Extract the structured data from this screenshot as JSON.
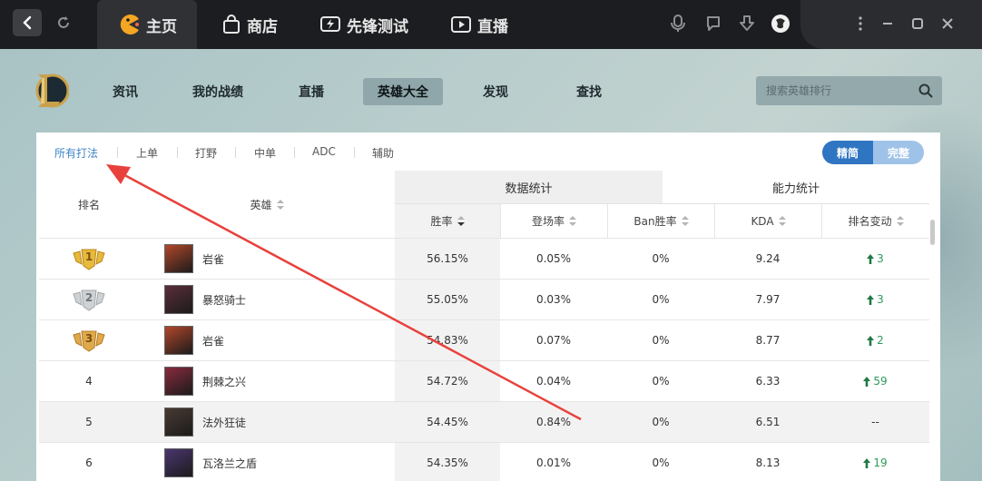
{
  "topbar": {
    "tabs": [
      {
        "label": "主页",
        "icon": "pacman-icon"
      },
      {
        "label": "商店",
        "icon": "shopping-bag-icon"
      },
      {
        "label": "先锋测试",
        "icon": "lightning-screen-icon"
      },
      {
        "label": "直播",
        "icon": "play-icon"
      }
    ],
    "active_tab": "主页",
    "accent": "#f5a623"
  },
  "subnav": {
    "items": [
      "资讯",
      "我的战绩",
      "直播",
      "英雄大全",
      "发现",
      "查找"
    ],
    "active": "英雄大全",
    "search_placeholder": "搜索英雄排行"
  },
  "filters": {
    "items": [
      "所有打法",
      "上单",
      "打野",
      "中单",
      "ADC",
      "辅助"
    ],
    "active": "所有打法",
    "toggle": {
      "left": "精简",
      "right": "完整",
      "selected": "精简"
    }
  },
  "table": {
    "group_headers": {
      "data": "数据统计",
      "ability": "能力统计"
    },
    "columns": {
      "rank": "排名",
      "hero": "英雄",
      "winrate": "胜率",
      "pickrate": "登场率",
      "banrate": "Ban胜率",
      "kda": "KDA",
      "change": "排名变动"
    },
    "rows": [
      {
        "rank": "1",
        "medal": "gold",
        "hero": "岩雀",
        "winrate": "56.15%",
        "pickrate": "0.05%",
        "banrate": "0%",
        "kda": "9.24",
        "change": "3",
        "trend": "up",
        "avatar_color": "#b2472a"
      },
      {
        "rank": "2",
        "medal": "silver",
        "hero": "暴怒骑士",
        "winrate": "55.05%",
        "pickrate": "0.03%",
        "banrate": "0%",
        "kda": "7.97",
        "change": "3",
        "trend": "up",
        "avatar_color": "#5b2f3a"
      },
      {
        "rank": "3",
        "medal": "bronze",
        "hero": "岩雀",
        "winrate": "54.83%",
        "pickrate": "0.07%",
        "banrate": "0%",
        "kda": "8.77",
        "change": "2",
        "trend": "up",
        "avatar_color": "#b2472a"
      },
      {
        "rank": "4",
        "medal": "none",
        "hero": "荆棘之兴",
        "winrate": "54.72%",
        "pickrate": "0.04%",
        "banrate": "0%",
        "kda": "6.33",
        "change": "59",
        "trend": "up",
        "avatar_color": "#8a2b3d"
      },
      {
        "rank": "5",
        "medal": "none",
        "hero": "法外狂徒",
        "winrate": "54.45%",
        "pickrate": "0.84%",
        "banrate": "0%",
        "kda": "6.51",
        "change": "--",
        "trend": "none",
        "avatar_color": "#4a3a33"
      },
      {
        "rank": "6",
        "medal": "none",
        "hero": "瓦洛兰之盾",
        "winrate": "54.35%",
        "pickrate": "0.01%",
        "banrate": "0%",
        "kda": "8.13",
        "change": "19",
        "trend": "up",
        "avatar_color": "#4b3670"
      }
    ]
  },
  "colors": {
    "trend_up": "#2e9a5a",
    "toggle_active": "#2f75c2",
    "filter_active": "#3f86c8",
    "annotation_arrow": "#e8413b"
  }
}
